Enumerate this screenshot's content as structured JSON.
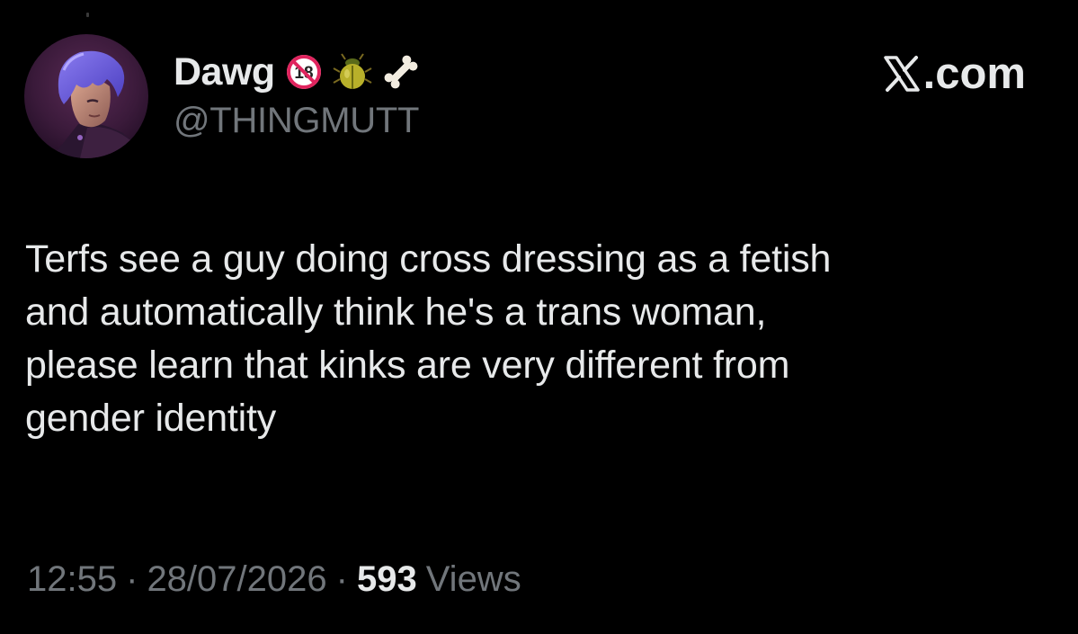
{
  "author": {
    "display_name": "Dawg",
    "handle": "@THINGMUTT",
    "avatar": "avatar-image",
    "name_emojis": [
      "no-under-18-icon",
      "beetle-icon",
      "bone-icon"
    ],
    "adult_badge_text": "18"
  },
  "brand": {
    "label": ".com",
    "icon": "x-logo-icon"
  },
  "tweet": {
    "text": "Terfs see a guy doing cross dressing as a fetish\nand automatically think he's a trans woman,\nplease learn that kinks are very different from\ngender identity"
  },
  "meta": {
    "time": "12:55",
    "separator": "·",
    "date": "28/07/2026",
    "views_count": "593",
    "views_label": "Views"
  },
  "colors": {
    "background": "#000000",
    "primary_text": "#e7e9ea",
    "secondary_text": "#71767b",
    "adult_badge_red": "#e0245e"
  }
}
